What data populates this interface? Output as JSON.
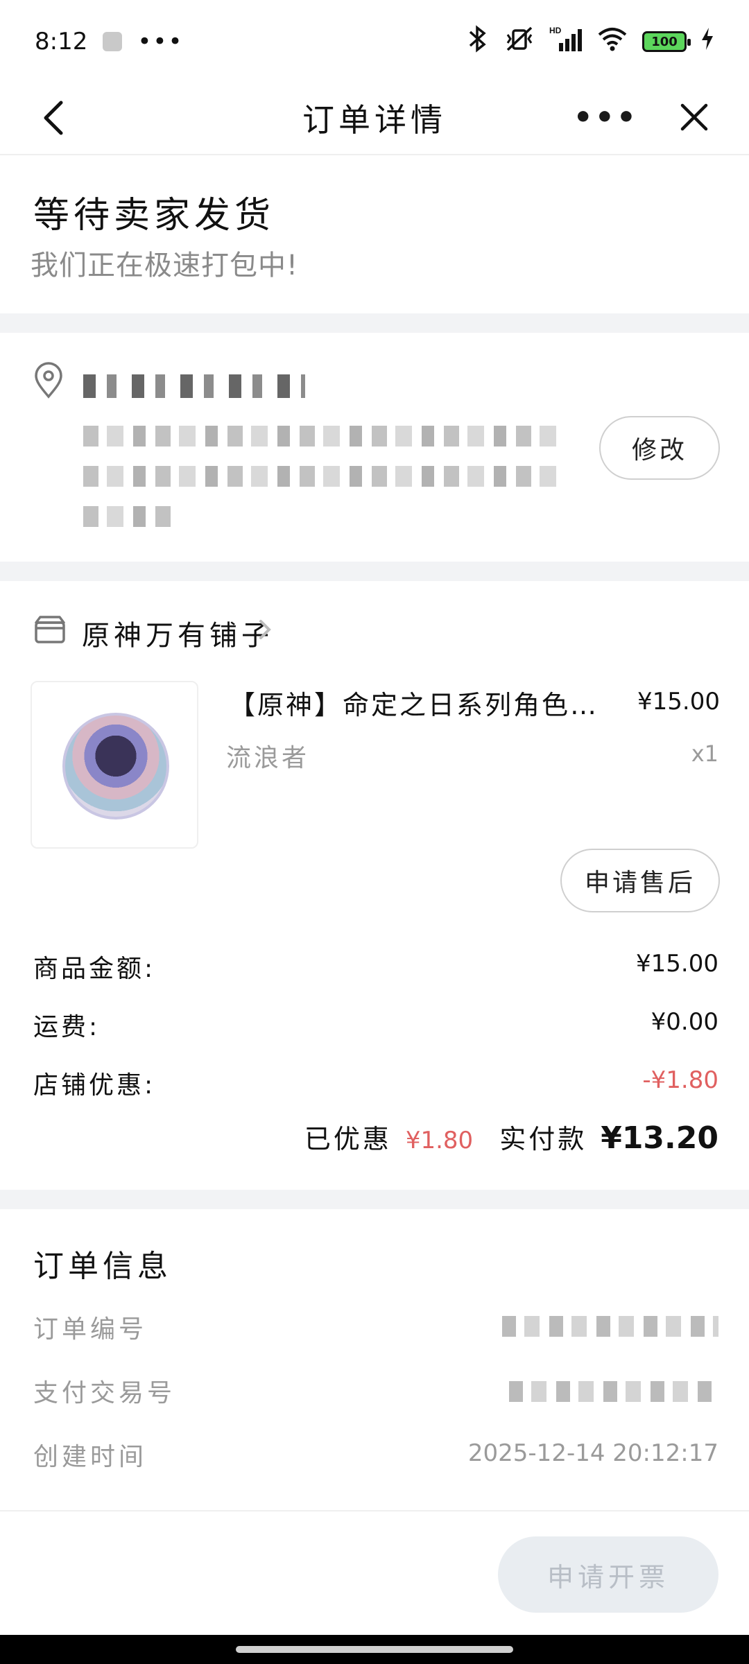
{
  "status_bar": {
    "time": "8:12",
    "dots": "•••",
    "battery": "100"
  },
  "header": {
    "title": "订单详情",
    "more": "•••"
  },
  "order_status": {
    "title": "等待卖家发货",
    "subtitle": "我们正在极速打包中!"
  },
  "address": {
    "edit_label": "修改"
  },
  "shop": {
    "name": "原神万有铺子"
  },
  "product": {
    "title": "【原神】命定之日系列角色…",
    "price": "¥15.00",
    "variant": "流浪者",
    "quantity": "x1",
    "after_sale_label": "申请售后"
  },
  "amounts": {
    "goods_label": "商品金额:",
    "goods_value": "¥15.00",
    "shipping_label": "运费:",
    "shipping_value": "¥0.00",
    "discount_label": "店铺优惠:",
    "discount_value": "-¥1.80",
    "saved_label": "已优惠",
    "saved_value": "¥1.80",
    "paid_label": "实付款",
    "paid_value": "¥13.20"
  },
  "order_info": {
    "title": "订单信息",
    "order_no_label": "订单编号",
    "trade_no_label": "支付交易号",
    "created_label": "创建时间",
    "created_value": "2025-12-14 20:12:17"
  },
  "bottom": {
    "invoice_label": "申请开票"
  },
  "colors": {
    "accent_red": "#e06060",
    "band_gray": "#f2f3f5"
  }
}
